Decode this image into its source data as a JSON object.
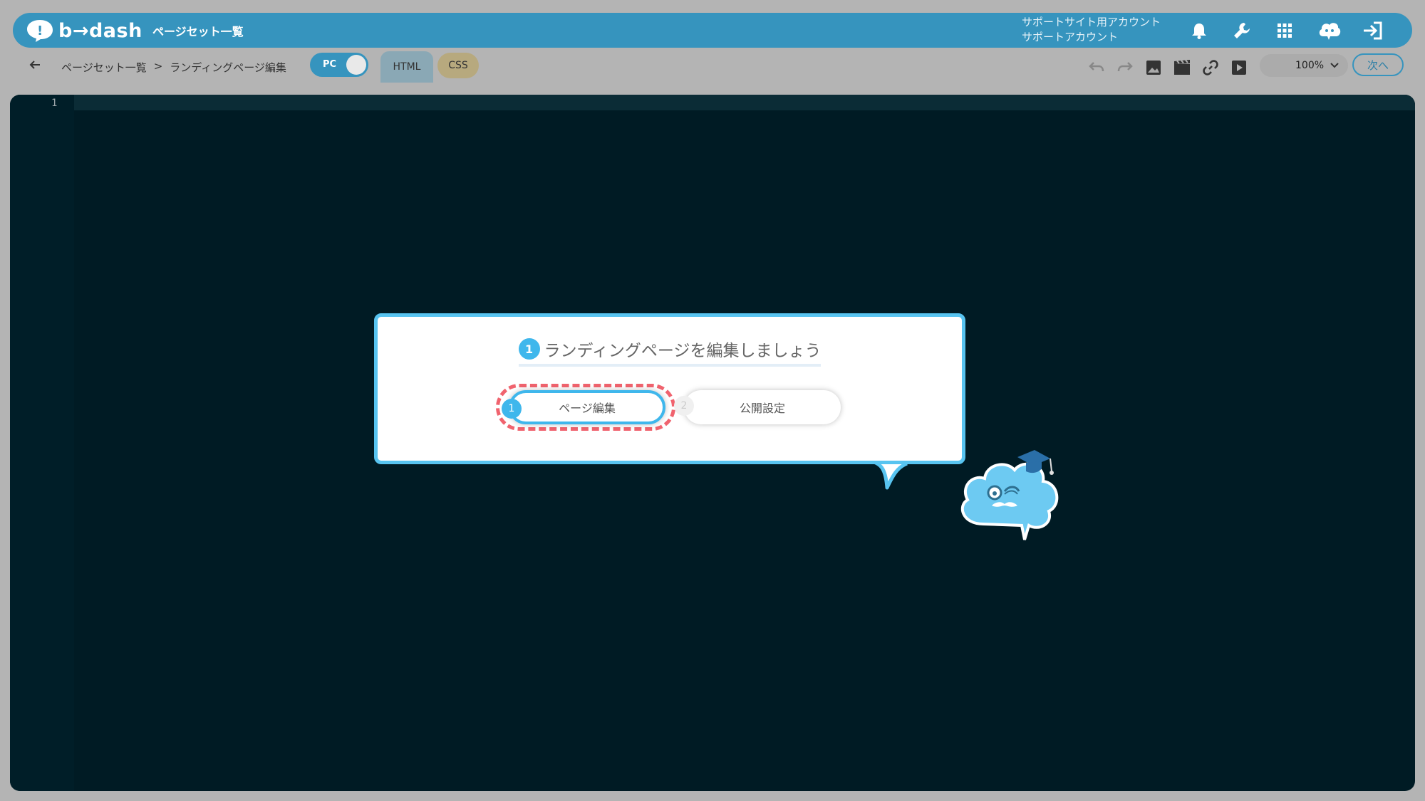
{
  "header": {
    "logo_text": "b→dash",
    "nav_label": "ページセット一覧",
    "account_line1": "サポートサイト用アカウント",
    "account_line2": "サポートアカウント",
    "icons": [
      "bell-icon",
      "wrench-icon",
      "apps-grid-icon",
      "cloud-mascot-icon",
      "logout-icon"
    ]
  },
  "toolbar": {
    "breadcrumb": [
      "ページセット一覧",
      ">",
      "ランディングページ編集"
    ],
    "device_toggle": "PC",
    "tabs": [
      {
        "label": "HTML"
      },
      {
        "label": "CSS"
      }
    ],
    "icons": [
      "undo-icon",
      "redo-icon",
      "image-icon",
      "video-icon",
      "link-icon",
      "play-icon"
    ],
    "zoom": "100%",
    "next_label": "次へ"
  },
  "editor": {
    "line_numbers": [
      "1"
    ]
  },
  "tutorial": {
    "title_number": "1",
    "title": "ランディングページを編集しましょう",
    "steps": [
      {
        "number": "1",
        "label": "ページ編集"
      },
      {
        "number": "2",
        "label": "公開設定"
      }
    ]
  },
  "colors": {
    "brand": "#3694be",
    "highlight": "#3fb7ec",
    "editor_bg": "#001b24",
    "dash_ring": "#f0636e"
  }
}
